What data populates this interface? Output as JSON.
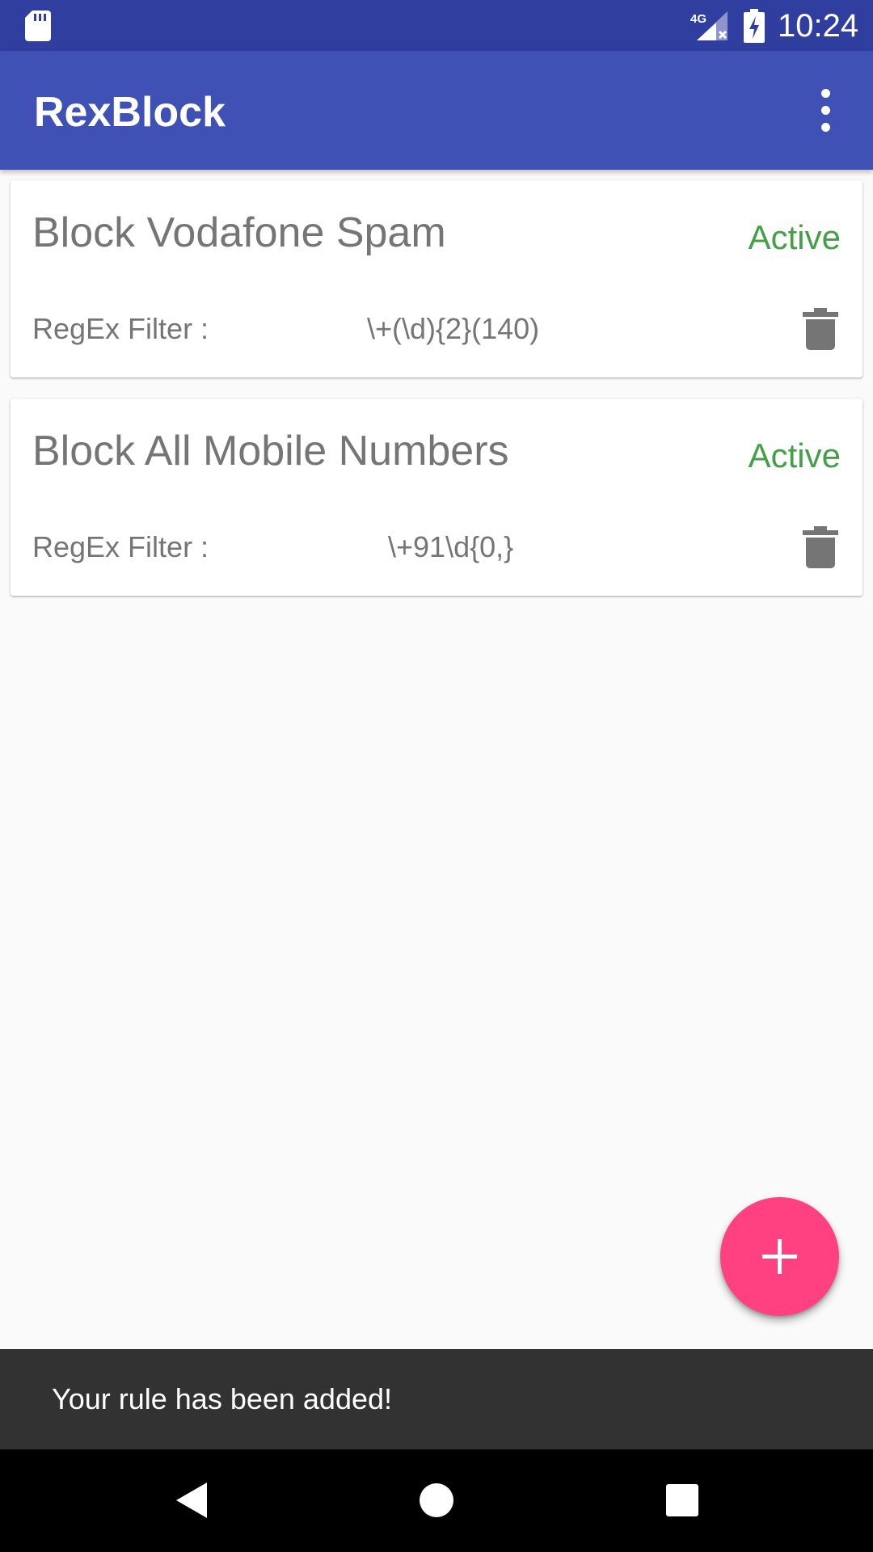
{
  "status_bar": {
    "time": "10:24",
    "network": "4G",
    "icons": [
      "sd-card-icon",
      "signal-icon",
      "battery-charging-icon"
    ]
  },
  "app_bar": {
    "title": "RexBlock",
    "menu_icon": "more-vert-icon"
  },
  "rules": [
    {
      "title": "Block Vodafone Spam",
      "status": "Active",
      "filter_label": "RegEx Filter :",
      "filter_value": "\\+(\\d){2}(140)",
      "delete_icon": "trash-icon"
    },
    {
      "title": "Block All Mobile Numbers",
      "status": "Active",
      "filter_label": "RegEx Filter :",
      "filter_value": "\\+91\\d{0,}",
      "delete_icon": "trash-icon"
    }
  ],
  "fab": {
    "icon": "plus-icon"
  },
  "snackbar": {
    "message": "Your rule has been added!"
  },
  "nav_bar": {
    "icons": [
      "back-icon",
      "home-icon",
      "recents-icon"
    ]
  },
  "colors": {
    "primary_dark": "#303f9f",
    "primary": "#3f51b5",
    "accent": "#ff4081",
    "active_status": "#43a047",
    "snackbar_bg": "#323232"
  }
}
